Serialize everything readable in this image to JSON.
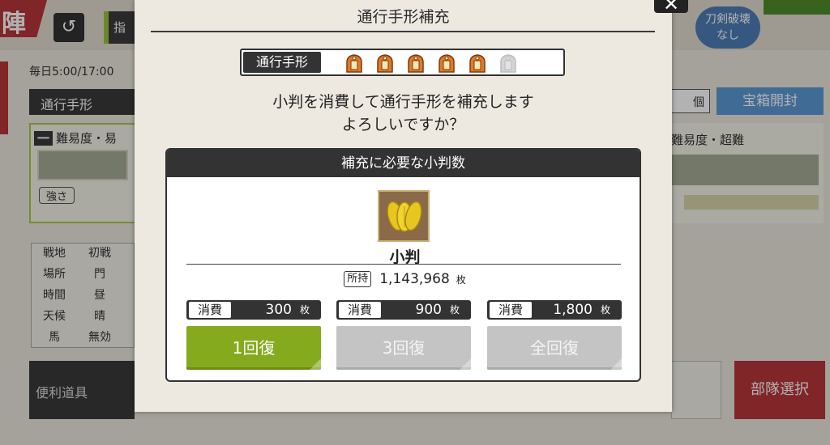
{
  "background": {
    "corner_tag": "陣",
    "shiji_label": "指",
    "daily_text": "毎日5:00/17:00",
    "pass_label": "通行手形",
    "area_number": "一",
    "area_difficulty_left": "難易度・易",
    "strength_label": "強さ",
    "table": [
      {
        "k": "戦地",
        "v": "初戦"
      },
      {
        "k": "場所",
        "v": "門"
      },
      {
        "k": "時間",
        "v": "昼"
      },
      {
        "k": "天候",
        "v": "晴"
      },
      {
        "k": "馬",
        "v": "無効"
      }
    ],
    "tools_label": "便利道具",
    "search_unit": "個",
    "chest_button": "宝箱開封",
    "area_difficulty_right": "難易度・超難",
    "sword_badge_line1": "刀剣破壊",
    "sword_badge_line2": "なし",
    "unit_select_button": "部隊選択"
  },
  "modal": {
    "title": "通行手形補充",
    "close_icon": "✕",
    "pass_label": "通行手形",
    "passes": {
      "filled": 5,
      "total": 6
    },
    "message_line1": "小判を消費して通行手形を補充します",
    "message_line2": "よろしいですか？",
    "panel_title": "補充に必要な小判数",
    "item_name": "小判",
    "owned_tag": "所持",
    "owned_amount": "1,143,968",
    "owned_unit": "枚",
    "options": [
      {
        "cost_tag": "消費",
        "cost": "300",
        "unit": "枚",
        "button": "1回復",
        "enabled": true
      },
      {
        "cost_tag": "消費",
        "cost": "900",
        "unit": "枚",
        "button": "3回復",
        "enabled": false
      },
      {
        "cost_tag": "消費",
        "cost": "1,800",
        "unit": "枚",
        "button": "全回復",
        "enabled": false
      }
    ],
    "colors": {
      "accent_green": "#86aa1e",
      "disabled_gray": "#c4c4c4",
      "pass_orange": "#e07a2a"
    }
  }
}
